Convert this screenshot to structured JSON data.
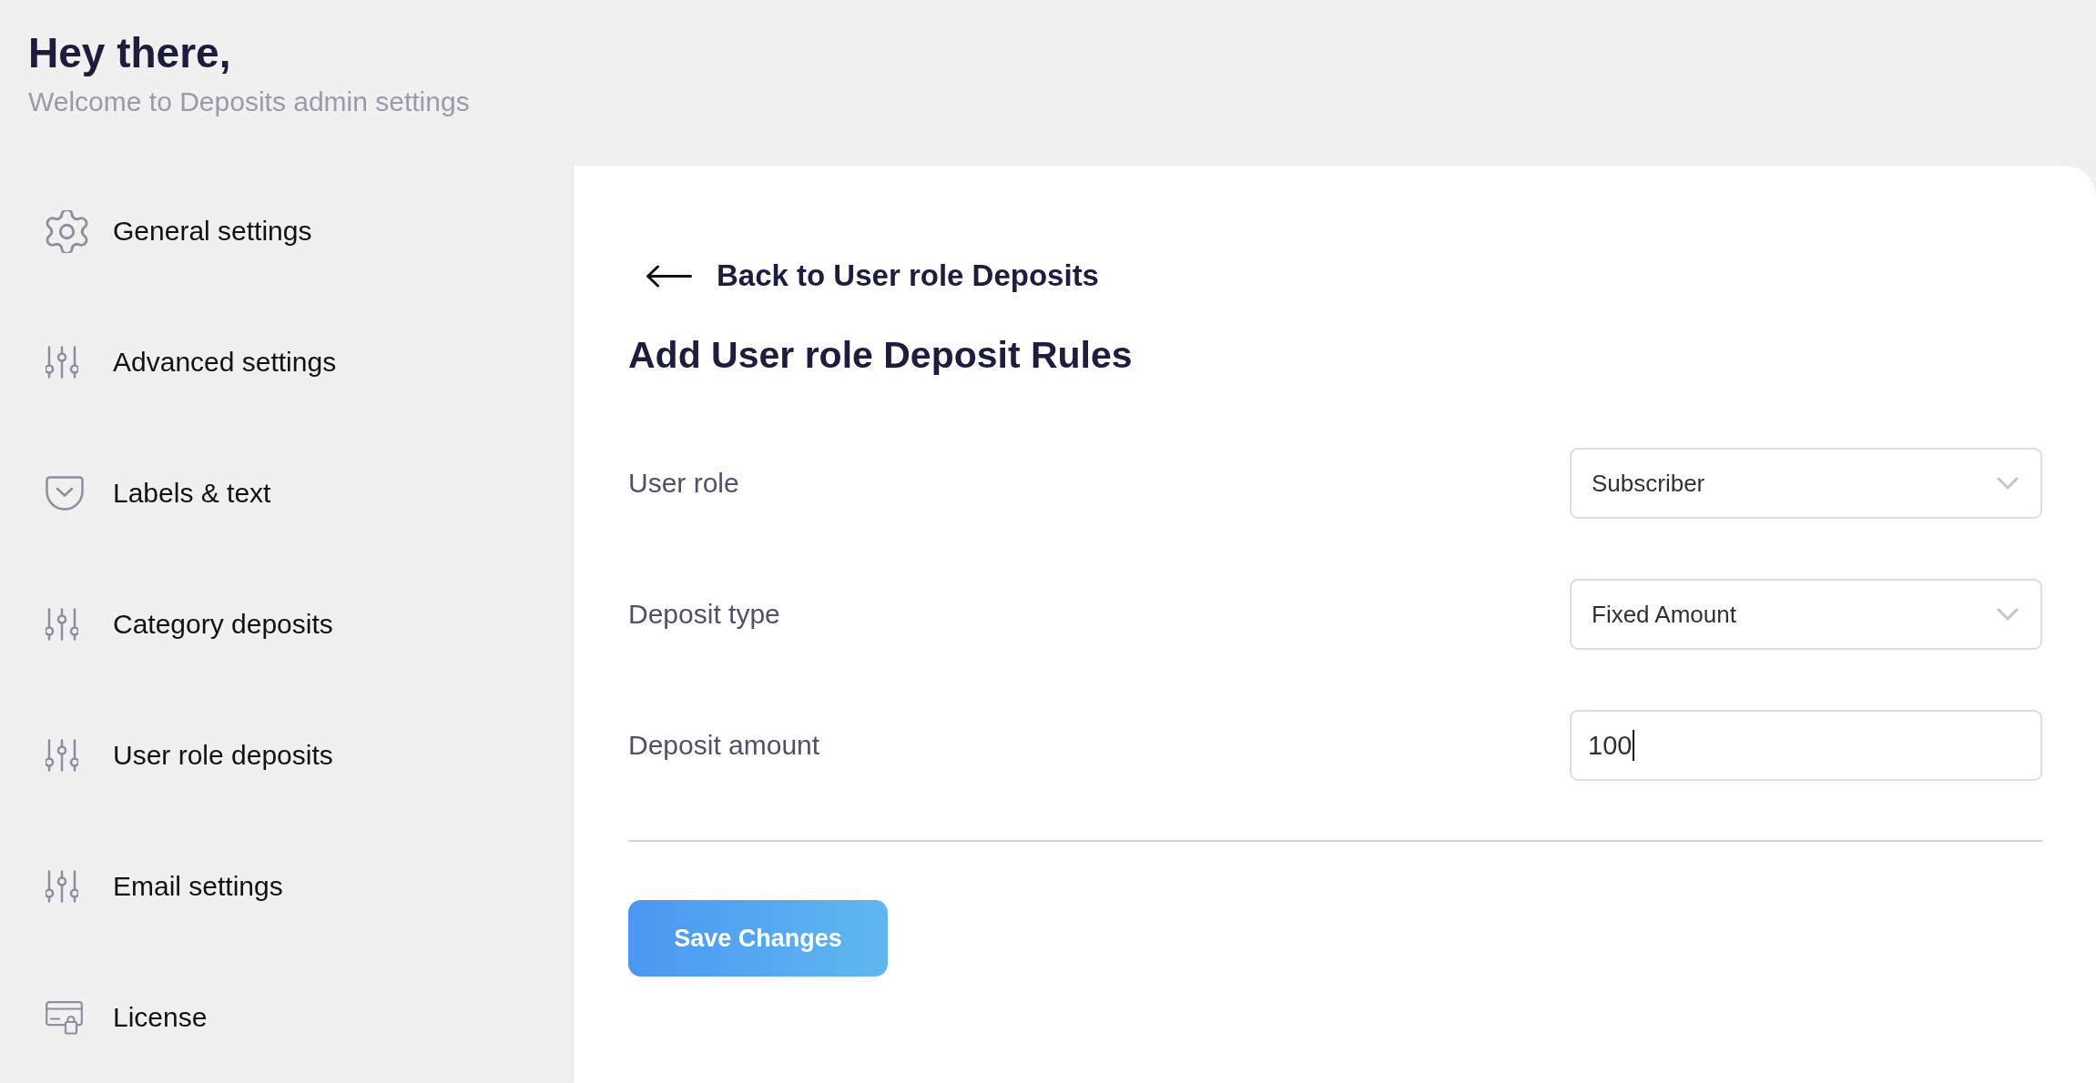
{
  "header": {
    "title": "Hey there,",
    "subtitle": "Welcome to Deposits admin settings"
  },
  "sidebar": {
    "items": [
      {
        "label": "General settings",
        "kind": "gear"
      },
      {
        "label": "Advanced settings",
        "kind": "sliders"
      },
      {
        "label": "Labels & text",
        "kind": "pocket"
      },
      {
        "label": "Category deposits",
        "kind": "sliders"
      },
      {
        "label": "User role deposits",
        "kind": "sliders"
      },
      {
        "label": "Email settings",
        "kind": "sliders"
      },
      {
        "label": "License",
        "kind": "card"
      }
    ]
  },
  "panel": {
    "back_link": "Back to User role Deposits",
    "title": "Add User role Deposit Rules",
    "fields": [
      {
        "label": "User role",
        "kind": "select",
        "value": "Subscriber"
      },
      {
        "label": "Deposit type",
        "kind": "select",
        "value": "Fixed Amount"
      },
      {
        "label": "Deposit amount",
        "kind": "input",
        "value": "100",
        "focused": true
      }
    ],
    "save_button": "Save Changes"
  }
}
